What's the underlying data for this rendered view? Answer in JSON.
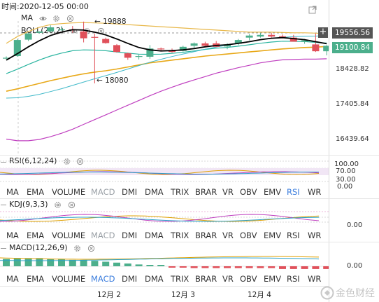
{
  "header": {
    "time_text": "时间:2020-12-05 00:00"
  },
  "main": {
    "ma_label": "MA",
    "boll_label": "BOLL(20,2)",
    "high_marker": "← 19888",
    "low_marker": "← 18080",
    "price_axis": [
      "19556.56",
      "19100.84",
      "18428.82",
      "17405.84",
      "16439.64"
    ],
    "crosshair_price": "19556.56",
    "last_price": "19100.84",
    "plus_button": "+"
  },
  "rsi": {
    "label": "RSI(6,12,24)",
    "axis": [
      "100.00",
      "70.00",
      "30.00",
      "0.00"
    ]
  },
  "kdj": {
    "label": "KDJ(9,3,3)",
    "axis": [
      "0.00"
    ]
  },
  "macd": {
    "label": "MACD(12,26,9)",
    "axis": [
      "0.00"
    ]
  },
  "indicator_tabs": [
    "MA",
    "EMA",
    "VOLUME",
    "MACD",
    "DMI",
    "DMA",
    "TRIX",
    "BRAR",
    "VR",
    "OBV",
    "EMV",
    "RSI",
    "WR"
  ],
  "date_axis": [
    "12月 2",
    "12月 3",
    "12月 4"
  ],
  "watermark": "金色财经",
  "colors": {
    "up": "#4caf8c",
    "down": "#e0505a",
    "ma": "#000000",
    "boll_mid": "#e8a817",
    "boll_up": "#e8b84a",
    "boll_low": "#c040c0",
    "accent": "#3b7ddd"
  },
  "chart_data": [
    {
      "type": "candlestick",
      "title": "",
      "ylabel": "",
      "ylim": [
        16000,
        20000
      ],
      "candles": [
        {
          "o": 18830,
          "h": 18870,
          "l": 18790,
          "c": 18830
        },
        {
          "o": 18880,
          "h": 19380,
          "l": 18860,
          "c": 19350
        },
        {
          "o": 19360,
          "h": 19560,
          "l": 19320,
          "c": 19540
        },
        {
          "o": 19560,
          "h": 19600,
          "l": 19540,
          "c": 19600
        },
        {
          "o": 19600,
          "h": 19780,
          "l": 19580,
          "c": 19720
        },
        {
          "o": 19660,
          "h": 19760,
          "l": 19620,
          "c": 19660
        },
        {
          "o": 19660,
          "h": 19760,
          "l": 19560,
          "c": 19640
        },
        {
          "o": 19600,
          "h": 19888,
          "l": 19280,
          "c": 19400
        },
        {
          "o": 19440,
          "h": 19540,
          "l": 18080,
          "c": 19420
        },
        {
          "o": 19380,
          "h": 19420,
          "l": 19240,
          "c": 19260
        },
        {
          "o": 19200,
          "h": 19230,
          "l": 18980,
          "c": 19000
        },
        {
          "o": 18960,
          "h": 18980,
          "l": 18770,
          "c": 18830
        },
        {
          "o": 18860,
          "h": 18920,
          "l": 18780,
          "c": 18880
        },
        {
          "o": 18860,
          "h": 19200,
          "l": 18800,
          "c": 19100
        },
        {
          "o": 19100,
          "h": 19130,
          "l": 19040,
          "c": 19080
        },
        {
          "o": 19040,
          "h": 19100,
          "l": 18980,
          "c": 19000
        },
        {
          "o": 19030,
          "h": 19180,
          "l": 19010,
          "c": 19150
        },
        {
          "o": 19180,
          "h": 19280,
          "l": 19100,
          "c": 19250
        },
        {
          "o": 19250,
          "h": 19300,
          "l": 19170,
          "c": 19180
        },
        {
          "o": 19250,
          "h": 19320,
          "l": 19140,
          "c": 19150
        },
        {
          "o": 19160,
          "h": 19260,
          "l": 19080,
          "c": 19220
        },
        {
          "o": 19240,
          "h": 19380,
          "l": 19200,
          "c": 19350
        },
        {
          "o": 19420,
          "h": 19520,
          "l": 19340,
          "c": 19480
        },
        {
          "o": 19450,
          "h": 19560,
          "l": 19420,
          "c": 19500
        },
        {
          "o": 19500,
          "h": 19560,
          "l": 19420,
          "c": 19450
        },
        {
          "o": 19460,
          "h": 19510,
          "l": 19420,
          "c": 19440
        },
        {
          "o": 19420,
          "h": 19500,
          "l": 19360,
          "c": 19300
        },
        {
          "o": 19300,
          "h": 19380,
          "l": 19240,
          "c": 19340
        },
        {
          "o": 19220,
          "h": 19540,
          "l": 19000,
          "c": 19020
        },
        {
          "o": 19020,
          "h": 19200,
          "l": 18900,
          "c": 19180
        }
      ],
      "ma_line": [
        18760,
        18950,
        19150,
        19330,
        19480,
        19580,
        19650,
        19640,
        19580,
        19500,
        19380,
        19250,
        19130,
        19060,
        19030,
        19040,
        19060,
        19100,
        19150,
        19190,
        19210,
        19250,
        19300,
        19360,
        19400,
        19420,
        19390,
        19360,
        19300,
        19240
      ],
      "boll_mid": [
        17850,
        17920,
        18000,
        18080,
        18160,
        18230,
        18300,
        18360,
        18410,
        18450,
        18500,
        18560,
        18620,
        18680,
        18720,
        18760,
        18800,
        18840,
        18880,
        18910,
        18940,
        18970,
        19000,
        19030,
        19060,
        19090,
        19110,
        19130,
        19140,
        19160
      ],
      "boll_up": [
        19250,
        19450,
        19600,
        19720,
        19800,
        19830,
        19850,
        19860,
        19850,
        19840,
        19820,
        19800,
        19780,
        19760,
        19740,
        19720,
        19700,
        19680,
        19660,
        19640,
        19620,
        19600,
        19580,
        19580,
        19580,
        19570,
        19560,
        19560,
        19550,
        19540
      ],
      "boll_low": [
        16450,
        16400,
        16400,
        16440,
        16520,
        16620,
        16740,
        16880,
        17020,
        17160,
        17300,
        17440,
        17580,
        17720,
        17850,
        17970,
        18080,
        18180,
        18280,
        18380,
        18460,
        18540,
        18610,
        18680,
        18730,
        18770,
        18780,
        18790,
        18790,
        18800
      ]
    }
  ]
}
